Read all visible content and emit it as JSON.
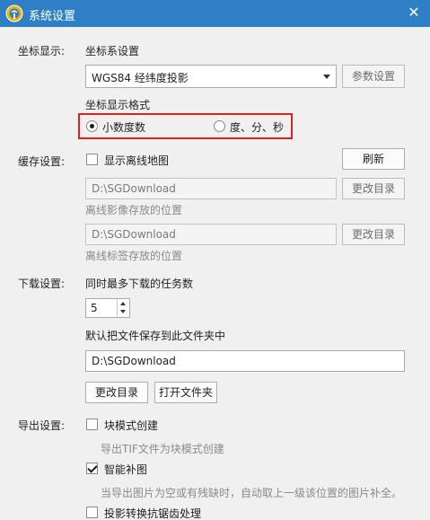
{
  "window": {
    "title": "系统设置",
    "close_glyph": "✕",
    "titlebar_color": "#2f7fc6",
    "app_icon": "app-globe-icon"
  },
  "coord_display": {
    "section_label": "坐标显示:",
    "crs_label": "坐标系设置",
    "crs_value": "WGS84 经纬度投影",
    "param_button": "参数设置",
    "format_label": "坐标显示格式",
    "format_options": [
      "小数度数",
      "度、分、秒"
    ],
    "format_selected": "小数度数",
    "highlight_color": "#e02020"
  },
  "cache": {
    "section_label": "缓存设置:",
    "show_offline_map_label": "显示离线地图",
    "show_offline_map_checked": false,
    "refresh_button": "刷新",
    "image_path": "D:\\SGDownload",
    "image_change_button": "更改目录",
    "image_hint": "离线影像存放的位置",
    "label_path": "D:\\SGDownload",
    "label_change_button": "更改目录",
    "label_hint": "离线标签存放的位置"
  },
  "download": {
    "section_label": "下载设置:",
    "max_tasks_label": "同时最多下载的任务数",
    "max_tasks_value": "5",
    "default_folder_label": "默认把文件保存到此文件夹中",
    "default_folder_value": "D:\\SGDownload",
    "change_dir_button": "更改目录",
    "open_folder_button": "打开文件夹"
  },
  "export": {
    "section_label": "导出设置:",
    "block_mode_label": "块模式创建",
    "block_mode_checked": false,
    "block_mode_hint": "导出TIF文件为块模式创建",
    "smart_fill_label": "智能补图",
    "smart_fill_checked": true,
    "smart_fill_hint": "当导出图片为空或有残缺时，自动取上一级该位置的图片补全。",
    "antialias_label": "投影转换抗锯齿处理",
    "antialias_checked": false
  }
}
